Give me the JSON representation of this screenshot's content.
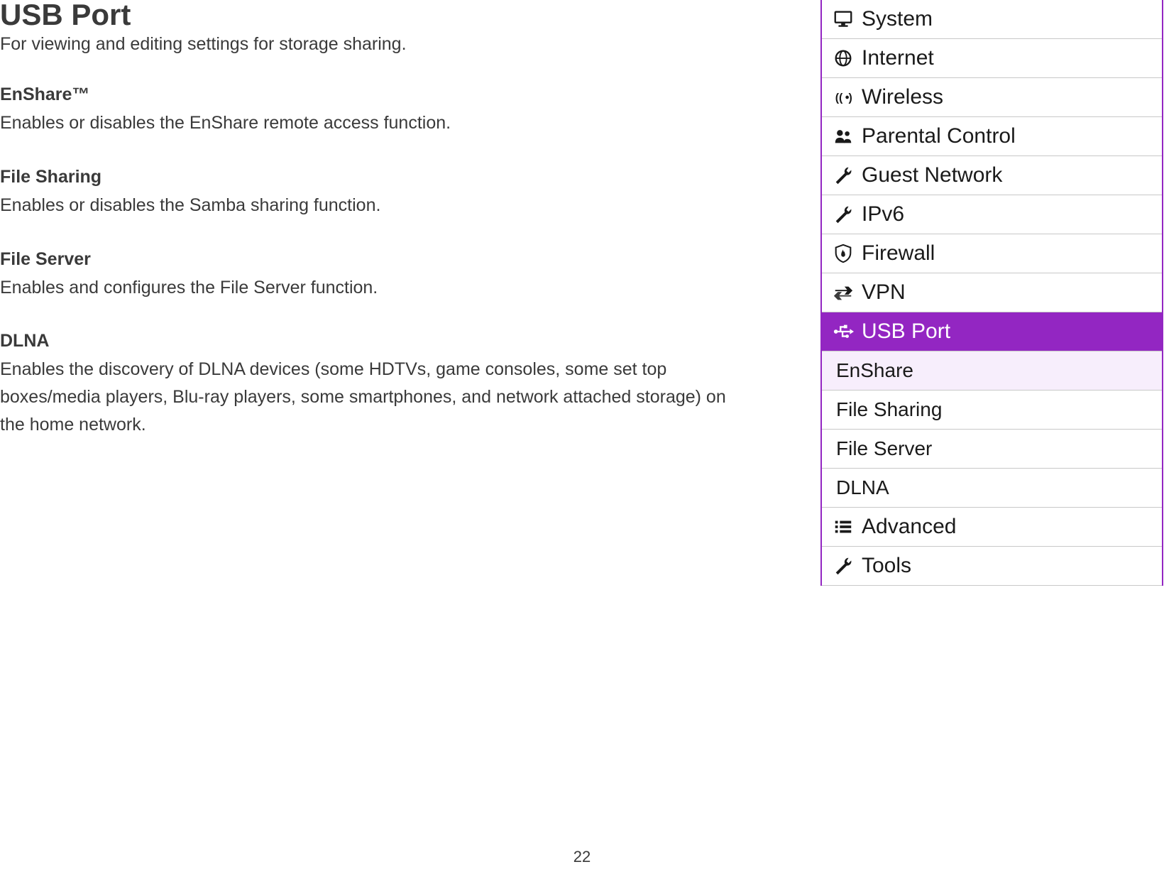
{
  "page": {
    "title": "USB Port",
    "intro": "For viewing and editing settings for storage sharing.",
    "number": "22"
  },
  "sections": [
    {
      "title": "EnShare™",
      "body": "Enables or disables the EnShare remote access function."
    },
    {
      "title": "File Sharing",
      "body": "Enables or disables the Samba sharing function."
    },
    {
      "title": "File Server",
      "body": "Enables and configures the File Server function."
    },
    {
      "title": "DLNA",
      "body": "Enables the discovery of DLNA devices (some HDTVs, game consoles, some set top boxes/media players, Blu-ray players, some smartphones, and network attached storage) on the home network."
    }
  ],
  "nav": {
    "items": [
      {
        "label": "System",
        "icon": "monitor"
      },
      {
        "label": "Internet",
        "icon": "globe"
      },
      {
        "label": "Wireless",
        "icon": "wifi"
      },
      {
        "label": "Parental Control",
        "icon": "people"
      },
      {
        "label": "Guest Network",
        "icon": "wrench"
      },
      {
        "label": "IPv6",
        "icon": "wrench"
      },
      {
        "label": "Firewall",
        "icon": "shield-fire"
      },
      {
        "label": "VPN",
        "icon": "exchange"
      },
      {
        "label": "USB Port",
        "icon": "usb",
        "active": true,
        "sub": [
          {
            "label": "EnShare",
            "selected": true
          },
          {
            "label": "File Sharing"
          },
          {
            "label": "File Server"
          },
          {
            "label": "DLNA"
          }
        ]
      },
      {
        "label": "Advanced",
        "icon": "list"
      },
      {
        "label": "Tools",
        "icon": "wrench"
      }
    ]
  }
}
